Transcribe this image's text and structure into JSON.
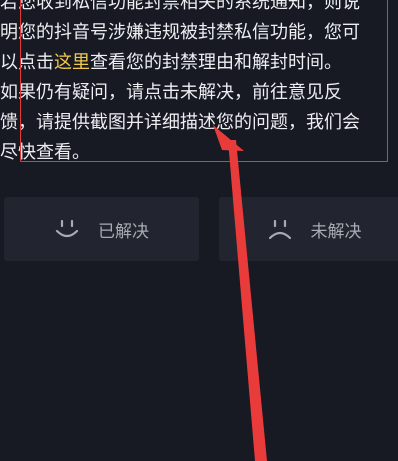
{
  "article": {
    "lines": [
      "若您收到私信功能封禁相关的系统通知，则说",
      "明您的抖音号涉嫌违规被封禁私信功能，您可",
      [
        "以点击",
        "这里",
        "查看您的封禁理由和解封时间。"
      ],
      "如果仍有疑问，请点击未解决，前往意见反",
      "馈，请提供截图并详细描述您的问题，我们会",
      "尽快查看。"
    ]
  },
  "feedback": {
    "resolved_label": "已解决",
    "unresolved_label": "未解决",
    "resolved_icon": "smile-icon",
    "unresolved_icon": "frown-icon"
  },
  "annotation": {
    "box_color": "#e23a3a",
    "arrow_color": "#ea3b3b"
  },
  "colors": {
    "background": "#171923",
    "text": "#eceef2",
    "link": "#f2c94c",
    "button_bg": "#22252f",
    "button_text": "#a8abb3"
  }
}
